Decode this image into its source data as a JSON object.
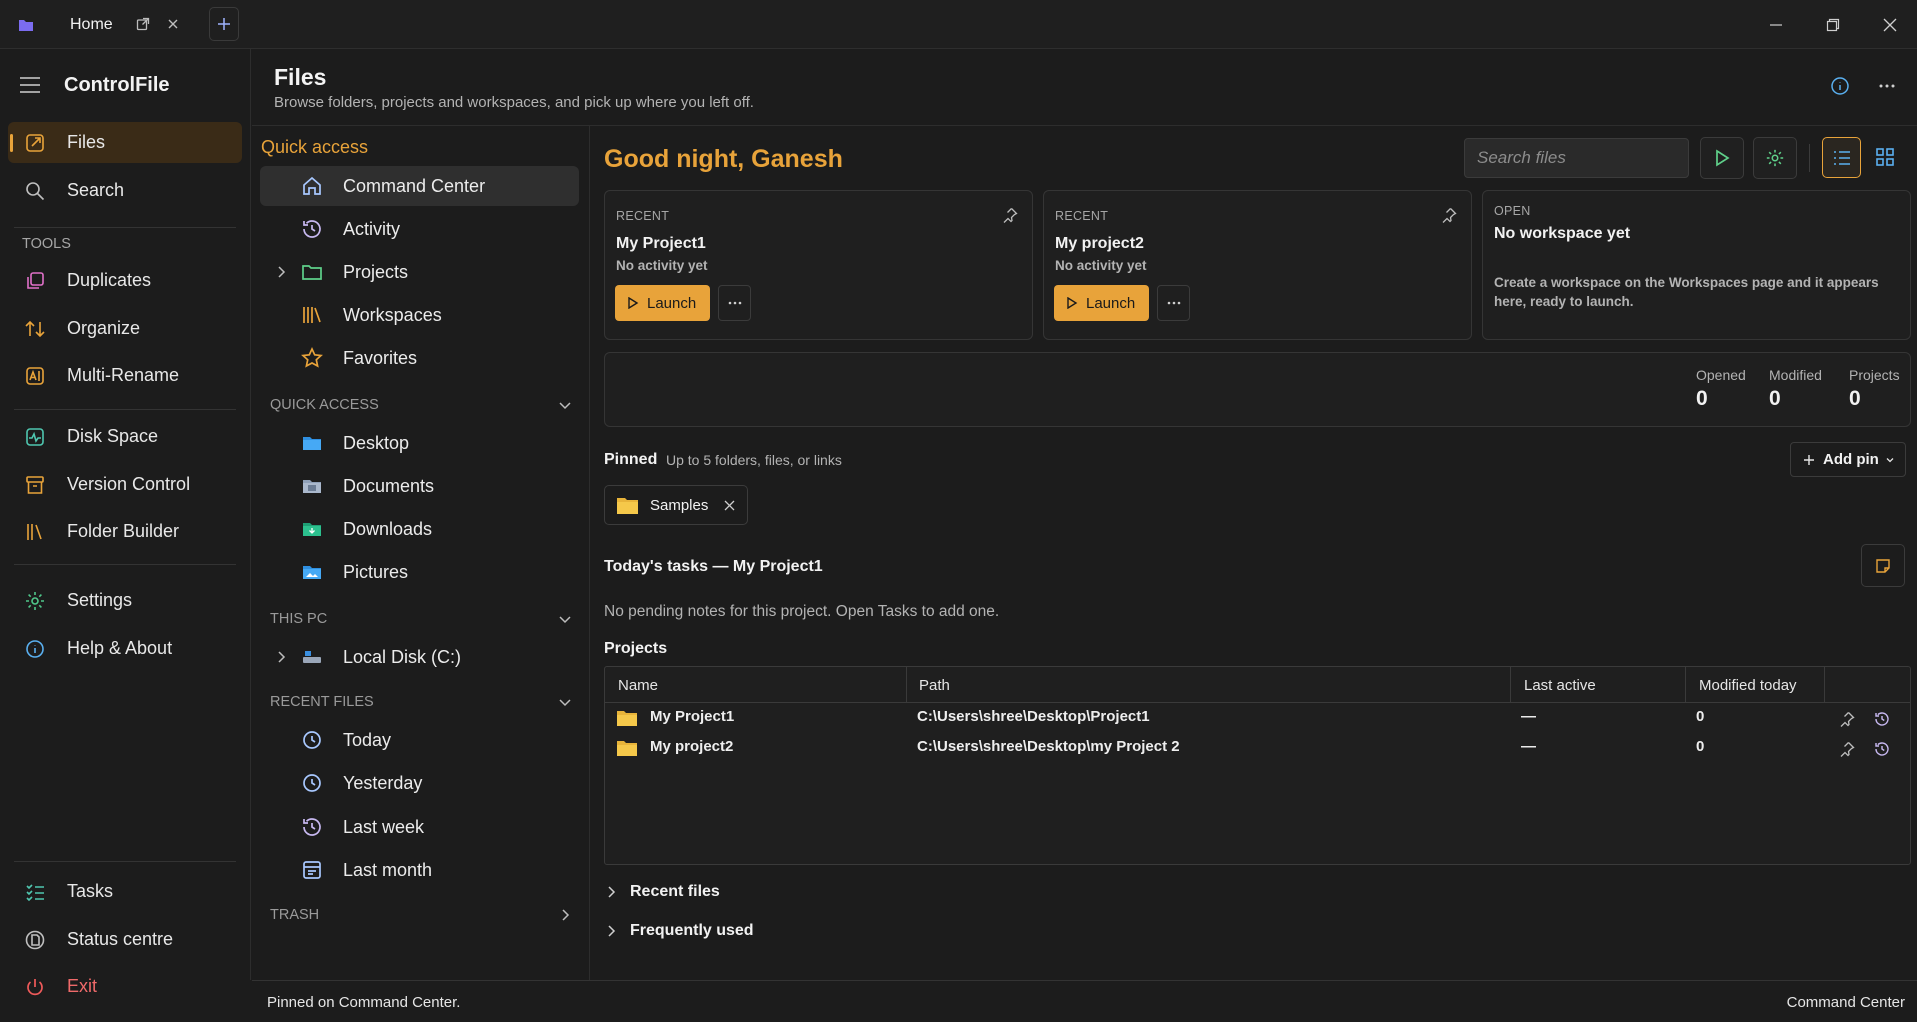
{
  "titlebar": {
    "tab_label": "Home",
    "new_tab_icon": "plus-icon",
    "colors": {
      "accent": "#e8a33a"
    }
  },
  "app": {
    "name": "ControlFile"
  },
  "sidebar": {
    "items_top": [
      {
        "label": "Files",
        "icon": "files-icon"
      },
      {
        "label": "Search",
        "icon": "search-icon"
      }
    ],
    "tools_heading": "TOOLS",
    "tools": [
      {
        "label": "Duplicates",
        "icon": "duplicates-icon"
      },
      {
        "label": "Organize",
        "icon": "organize-icon"
      },
      {
        "label": "Multi-Rename",
        "icon": "rename-icon"
      }
    ],
    "group2": [
      {
        "label": "Disk Space",
        "icon": "disk-space-icon"
      },
      {
        "label": "Version Control",
        "icon": "archive-icon"
      },
      {
        "label": "Folder Builder",
        "icon": "folder-builder-icon"
      }
    ],
    "group3": [
      {
        "label": "Settings",
        "icon": "gear-icon"
      },
      {
        "label": "Help & About",
        "icon": "info-icon"
      }
    ],
    "bottom": [
      {
        "label": "Tasks",
        "icon": "tasks-icon"
      },
      {
        "label": "Status centre",
        "icon": "status-icon"
      },
      {
        "label": "Exit",
        "icon": "power-icon"
      }
    ]
  },
  "header": {
    "title": "Files",
    "subtitle": "Browse folders, projects and workspaces, and pick up where you left off."
  },
  "nav": {
    "quick_access_title": "Quick access",
    "quick_items": [
      {
        "label": "Command Center",
        "icon": "home-icon"
      },
      {
        "label": "Activity",
        "icon": "history-icon"
      },
      {
        "label": "Projects",
        "icon": "folder-icon"
      },
      {
        "label": "Workspaces",
        "icon": "workspaces-icon"
      },
      {
        "label": "Favorites",
        "icon": "star-icon"
      }
    ],
    "quick_access_section": "QUICK ACCESS",
    "folders": [
      {
        "label": "Desktop",
        "icon": "desktop-folder-icon"
      },
      {
        "label": "Documents",
        "icon": "documents-folder-icon"
      },
      {
        "label": "Downloads",
        "icon": "downloads-folder-icon"
      },
      {
        "label": "Pictures",
        "icon": "pictures-folder-icon"
      }
    ],
    "this_pc_section": "THIS PC",
    "drives": [
      {
        "label": "Local Disk (C:)",
        "icon": "drive-icon"
      }
    ],
    "recent_files_section": "RECENT FILES",
    "recent": [
      {
        "label": "Today",
        "icon": "clock-icon"
      },
      {
        "label": "Yesterday",
        "icon": "clock-icon"
      },
      {
        "label": "Last week",
        "icon": "history-icon"
      },
      {
        "label": "Last month",
        "icon": "calendar-icon"
      }
    ],
    "trash_section": "TRASH"
  },
  "main": {
    "greeting": "Good night, Ganesh",
    "search_placeholder": "Search files",
    "cards": [
      {
        "kicker": "RECENT",
        "title": "My Project1",
        "sub": "No activity yet",
        "launch": "Launch"
      },
      {
        "kicker": "RECENT",
        "title": "My project2",
        "sub": "No activity yet",
        "launch": "Launch"
      }
    ],
    "open_card": {
      "kicker": "OPEN",
      "title": "No workspace yet",
      "body": "Create a workspace on the Workspaces page and it appears here, ready to launch."
    },
    "stats": [
      {
        "label": "Opened",
        "value": "0"
      },
      {
        "label": "Modified",
        "value": "0"
      },
      {
        "label": "Projects",
        "value": "0"
      }
    ],
    "pinned": {
      "title": "Pinned",
      "hint": "Up to 5 folders, files, or links",
      "add_label": "Add pin",
      "chips": [
        {
          "label": "Samples"
        }
      ]
    },
    "tasks": {
      "title": "Today's tasks — My Project1",
      "empty": "No pending notes for this project. Open Tasks to add one."
    },
    "projects": {
      "title": "Projects",
      "columns": [
        "Name",
        "Path",
        "Last active",
        "Modified today"
      ],
      "rows": [
        {
          "name": "My Project1",
          "path": "C:\\Users\\shree\\Desktop\\Project1",
          "last_active": "—",
          "modified_today": "0"
        },
        {
          "name": "My project2",
          "path": "C:\\Users\\shree\\Desktop\\my Project 2",
          "last_active": "—",
          "modified_today": "0"
        }
      ]
    },
    "collapsibles": [
      {
        "label": "Recent files"
      },
      {
        "label": "Frequently used"
      }
    ]
  },
  "statusbar": {
    "left": "Pinned on Command Center.",
    "right": "Command Center"
  }
}
